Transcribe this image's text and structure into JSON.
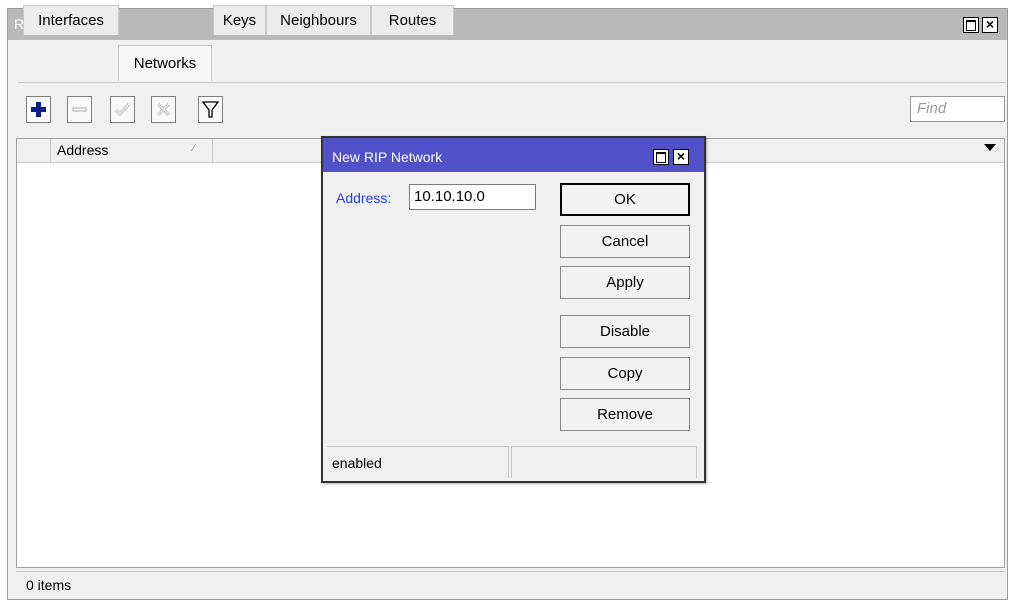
{
  "window": {
    "title": "RIP"
  },
  "tabs": [
    {
      "label": "Interfaces",
      "active": false
    },
    {
      "label": "Networks",
      "active": true
    },
    {
      "label": "Keys",
      "active": false
    },
    {
      "label": "Neighbours",
      "active": false
    },
    {
      "label": "Routes",
      "active": false
    }
  ],
  "toolbar": {
    "buttons": [
      "add-icon",
      "remove-icon",
      "enable-icon",
      "disable-icon",
      "filter-icon"
    ],
    "find_placeholder": "Find"
  },
  "list": {
    "columns": [
      "Address"
    ],
    "rows": []
  },
  "status": {
    "items_text": "0 items"
  },
  "dialog": {
    "title": "New RIP Network",
    "address_label": "Address:",
    "address_value": "10.10.10.0",
    "buttons": {
      "ok": "OK",
      "cancel": "Cancel",
      "apply": "Apply",
      "disable": "Disable",
      "copy": "Copy",
      "remove": "Remove"
    },
    "status_text": "enabled"
  },
  "colors": {
    "dialog_title_bar": "#5050c8",
    "window_title_bar": "#b9b9b9",
    "label_blue": "#1f40e6",
    "add_icon": "#0a1e8c"
  }
}
